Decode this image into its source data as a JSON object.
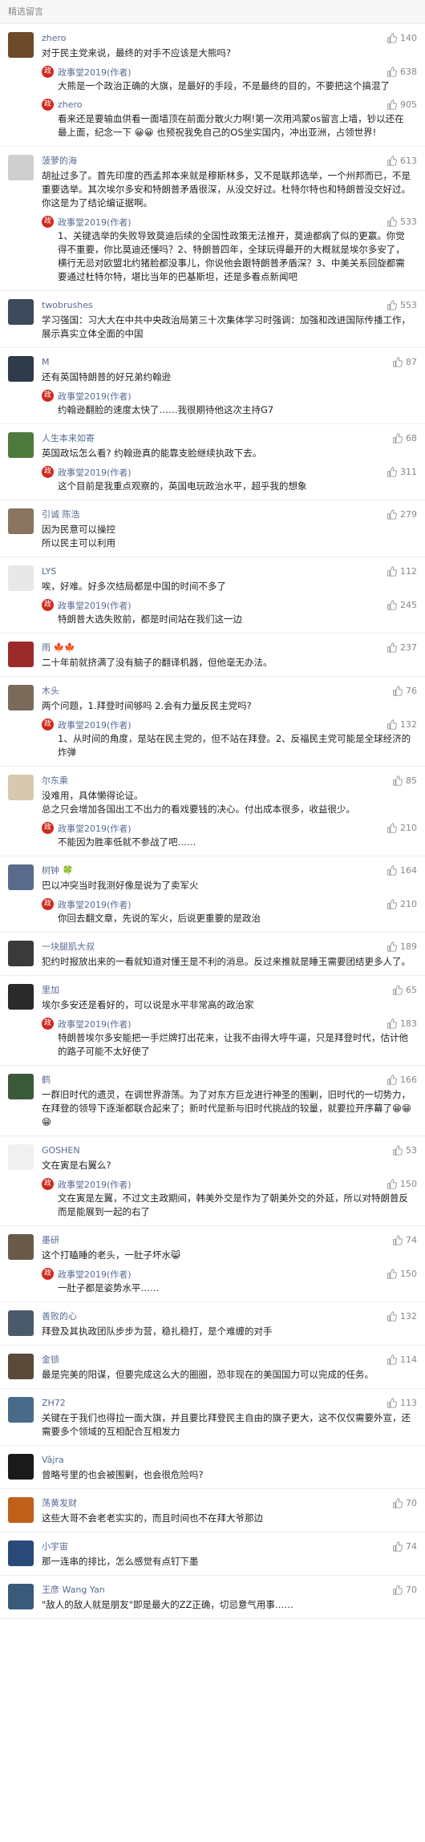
{
  "section_title": "精选留言",
  "colors": {
    "username": "#576b95",
    "reply_avatar": "#d0281e",
    "text": "#222222",
    "meta": "#888888"
  },
  "icons": {
    "like": "thumbs-up-icon",
    "reply_avatar": "official-account-avatar"
  },
  "comments": [
    {
      "user": "zhero",
      "likes": "140",
      "text": "对于民主党来说，最终的对手不应该是大熊吗?",
      "avatar_color": "#6d4a2a",
      "replies": [
        {
          "user": "政事堂2019(作者)",
          "likes": "638",
          "text": "大熊是一个政治正确的大旗，是最好的手段，不是最终的目的，不要把这个搞混了"
        },
        {
          "user": "zhero",
          "likes": "905",
          "text": "看来还是要输血供看一面墙顶在前面分散火力啊!第一次用鸿蒙os留言上墙，钞以还在最上面，纪念一下 😀😀 也预祝我免自己的OS坐实国内，冲出亚洲，占领世界!"
        }
      ]
    },
    {
      "user": "菠萝的海",
      "likes": "613",
      "text": "胡扯过多了。首先印度的西孟邦本来就是穆斯林多，又不是联邦选举，一个州邦而已，不是重要选举。其次埃尔多安和特朗普矛盾很深，从没交好过。杜特尔特也和特朗普没交好过。你这是为了结论编证据啊。",
      "avatar_color": "#cfcfcf",
      "replies": [
        {
          "user": "政事堂2019(作者)",
          "likes": "533",
          "text": "1、关键选举的失败导致莫迪后续的全国性政策无法推开，莫迪都病了似的更嬴。你觉得不重要，你比莫迪还懂吗？2、特朗普四年，全球玩得最开的大概就是埃尔多安了，横行无忌对欧盟北约猪脸都没事儿，你说他会跟特朗普矛盾深？3、中美关系回旋都需要通过杜特尔特，堪比当年的巴基斯坦，还是多看点新闻吧"
        }
      ]
    },
    {
      "user": "twobrushes",
      "likes": "553",
      "text": "学习强国：习大大在中共中央政治局第三十次集体学习时强调：加强和改进国际传播工作，展示真实立体全面的中国",
      "avatar_color": "#3d4a5c",
      "replies": []
    },
    {
      "user": "M",
      "likes": "87",
      "text": "还有英国特朗普的好兄弟约翰逊",
      "avatar_color": "#2f3a4a",
      "replies": [
        {
          "user": "政事堂2019(作者)",
          "likes": "",
          "text": "约翰逊翻脸的速度太快了……我很期待他这次主持G7"
        }
      ]
    },
    {
      "user": "人生本来如寄",
      "likes": "68",
      "text": "英国政坛怎么看? 约翰逊真的能靠支脸继续执政下去。",
      "avatar_color": "#4f7a3e",
      "replies": [
        {
          "user": "政事堂2019(作者)",
          "likes": "311",
          "text": "这个目前是我重点观察的，英国电玩政治水平，超乎我的想象"
        }
      ]
    },
    {
      "user": "引诚 陈浩",
      "likes": "279",
      "text": "因为民意可以操控\n所以民主可以利用",
      "avatar_color": "#8a7560",
      "replies": []
    },
    {
      "user": "LYS",
      "likes": "112",
      "text": "唉，好难。好多次结局都是中国的时间不多了",
      "avatar_color": "#e8e8e8",
      "replies": [
        {
          "user": "政事堂2019(作者)",
          "likes": "245",
          "text": "特朗普大选失败前，都是时间站在我们这一边"
        }
      ]
    },
    {
      "user": "雨 🍁🍁",
      "likes": "237",
      "text": "二十年前就挤满了没有脑子的翻译机器，但他毫无办法。",
      "avatar_color": "#9b2b2b",
      "replies": []
    },
    {
      "user": "木头",
      "likes": "76",
      "text": "两个问题，1.拜登时间够吗 2.会有力量反民主党吗?",
      "avatar_color": "#7a6a5a",
      "replies": [
        {
          "user": "政事堂2019(作者)",
          "likes": "132",
          "text": "1、从时间的角度，是站在民主党的，但不站在拜登。2、反福民主党可能是全球经济的炸弹"
        }
      ]
    },
    {
      "user": "尔东乘",
      "likes": "85",
      "text": "没难用，具体懒得论证。\n总之只会增加各国出工不出力的看戏要钱的决心。付出成本很多，收益很少。",
      "avatar_color": "#d8c8b0",
      "replies": [
        {
          "user": "政事堂2019(作者)",
          "likes": "210",
          "text": "不能因为胜率低就不参战了吧……"
        }
      ]
    },
    {
      "user": "树钟 🍀",
      "likes": "164",
      "text": "巴以冲突当时我测好像是说为了卖军火",
      "avatar_color": "#5a6a8a",
      "replies": [
        {
          "user": "政事堂2019(作者)",
          "likes": "210",
          "text": "你回去翻文章，先说的军火，后说更重要的是政治"
        }
      ]
    },
    {
      "user": "一块腿肌大叔",
      "likes": "189",
      "text": "犯约时报放出来的一看就知道对懂王是不利的消息。反过来推就是睡王需要团结更多人了。",
      "avatar_color": "#3a3a3a",
      "replies": []
    },
    {
      "user": "里加",
      "likes": "65",
      "text": "埃尔多安还是看好的，可以说是水平非常高的政治家",
      "avatar_color": "#2a2a2a",
      "replies": [
        {
          "user": "政事堂2019(作者)",
          "likes": "183",
          "text": "特朗普埃尔多安能把一手烂牌打出花来，让我不由得大呼牛逼，只是拜登时代，估计他的路子可能不太好使了"
        }
      ]
    },
    {
      "user": "鹤",
      "likes": "166",
      "text": "一群旧时代的遗灵，在调世界游荡。为了对东方巨龙进行神圣的围剿，旧时代的一切势力，在拜登的领导下逐渐都联合起来了；新时代是新与旧时代挑战的较量，就要拉开序幕了😁😁😁",
      "avatar_color": "#3a5a3a",
      "replies": []
    },
    {
      "user": "GOSHEN",
      "likes": "53",
      "text": "文在寅是右翼么?",
      "avatar_color": "#f0f0f0",
      "replies": [
        {
          "user": "政事堂2019(作者)",
          "likes": "150",
          "text": "文在寅是左翼，不过文主政期间，韩美外交是作为了朝美外交的外延，所以对特朗普反而是能展到一起的右了"
        }
      ]
    },
    {
      "user": "墨研",
      "likes": "74",
      "text": "这个打瞌睡的老头，一肚子坏水😸",
      "avatar_color": "#6a5a4a",
      "replies": [
        {
          "user": "政事堂2019(作者)",
          "likes": "150",
          "text": "一肚子都是姿势水平……"
        }
      ]
    },
    {
      "user": "善败的心",
      "likes": "132",
      "text": "拜登及其执政团队步步为营，稳扎稳打，是个难缠的对手",
      "avatar_color": "#4a5a6a",
      "replies": []
    },
    {
      "user": "金锁",
      "likes": "114",
      "text": "最是完美的阳谋，但要完成这么大的圈圈，恐非现在的美国国力可以完成的任务。",
      "avatar_color": "#5a4a3a",
      "replies": []
    },
    {
      "user": "ZH72",
      "likes": "113",
      "text": "关键在于我们也得拉一面大旗，并且要比拜登民主自由的旗子更大，这不仅仅需要外宣，还需要多个领域的互相配合互相发力",
      "avatar_color": "#4a6a8a",
      "replies": []
    },
    {
      "user": "Vâjra",
      "likes": "",
      "text": "曾略号里的也会被围剿，也会很危险吗?",
      "avatar_color": "#1a1a1a",
      "replies": []
    },
    {
      "user": "荡黄发财",
      "likes": "70",
      "text": "这些大哥不会老老实实的，而且时间也不在拜大爷那边",
      "avatar_color": "#c0601a",
      "replies": []
    },
    {
      "user": "小宇宙",
      "likes": "74",
      "text": "那一连串的排比，怎么感觉有点钉下墨",
      "avatar_color": "#2a4a7a",
      "replies": []
    },
    {
      "user": "王彦 Wang Yan",
      "likes": "70",
      "text": "\"敌人的敌人就是朋友\"即是最大的ZZ正确，切忌意气用事……",
      "avatar_color": "#3a5a7a",
      "replies": []
    }
  ]
}
